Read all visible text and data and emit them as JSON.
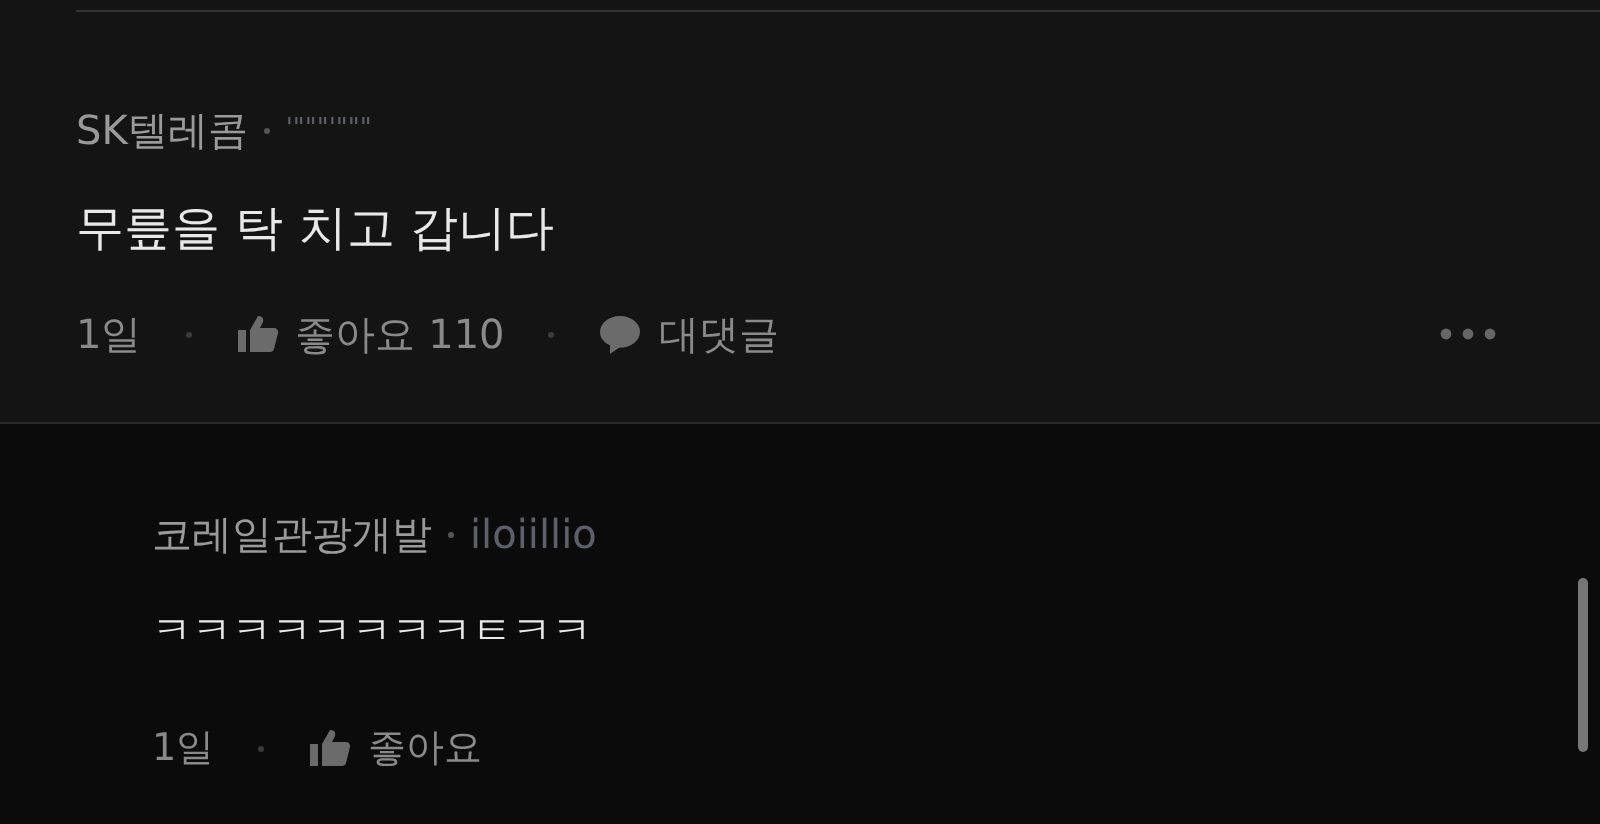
{
  "comments": [
    {
      "kind": "comment",
      "author": "SK텔레콤",
      "handle": "'\"\"\"'\"\"\"",
      "body": "무릎을 탁 치고 갑니다",
      "time": "1일",
      "like_label": "좋아요",
      "like_count": "110",
      "reply_label": "대댓글",
      "more": true
    },
    {
      "kind": "reply",
      "author": "코레일관광개발",
      "handle": "iloiillio",
      "body": "ㅋㅋㅋㅋㅋㅋㅋㅋㅌㅋㅋ",
      "time": "1일",
      "like_label": "좋아요"
    }
  ]
}
